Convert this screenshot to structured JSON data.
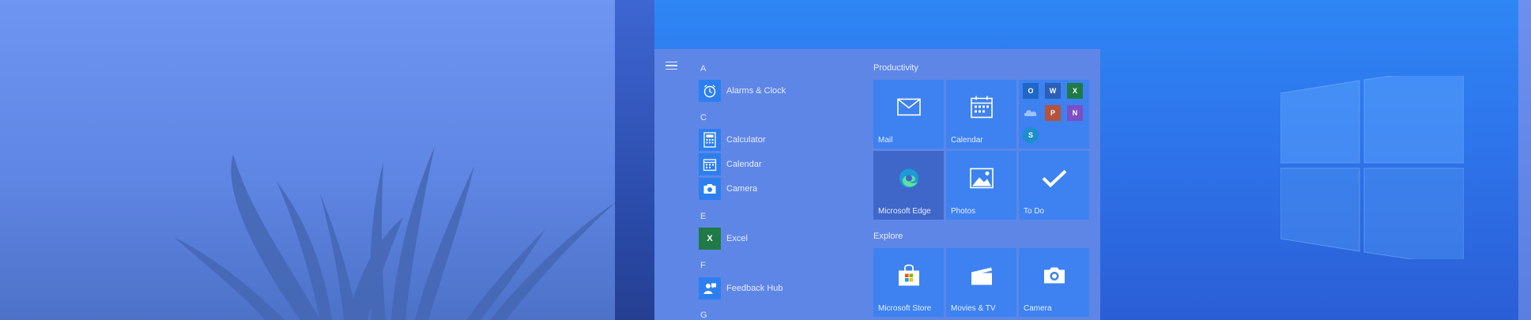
{
  "start_menu": {
    "apps": [
      {
        "letter": "A",
        "label": "Alarms & Clock",
        "icon": "alarm-clock-icon"
      },
      {
        "letter": "C",
        "label": "Calculator",
        "icon": "calculator-icon"
      },
      {
        "letter": "",
        "label": "Calendar",
        "icon": "calendar-icon"
      },
      {
        "letter": "",
        "label": "Camera",
        "icon": "camera-icon"
      },
      {
        "letter": "E",
        "label": "Excel",
        "icon": "excel-icon"
      },
      {
        "letter": "F",
        "label": "Feedback Hub",
        "icon": "feedback-hub-icon"
      },
      {
        "letter": "G",
        "label": "",
        "icon": ""
      }
    ],
    "groups": [
      {
        "title": "Productivity",
        "tiles": [
          "Mail",
          "Calendar",
          "",
          "Microsoft Edge",
          "Photos",
          "To Do"
        ]
      },
      {
        "title": "Explore",
        "tiles": [
          "Microsoft Store",
          "Movies & TV",
          "Camera"
        ]
      }
    ],
    "office_mini_letters": [
      "O",
      "W",
      "X",
      "P",
      "N",
      "S"
    ]
  },
  "colors": {
    "accent": "#2d7ff0",
    "rail": "#2a4aa8",
    "panel": "#5e86e6"
  }
}
